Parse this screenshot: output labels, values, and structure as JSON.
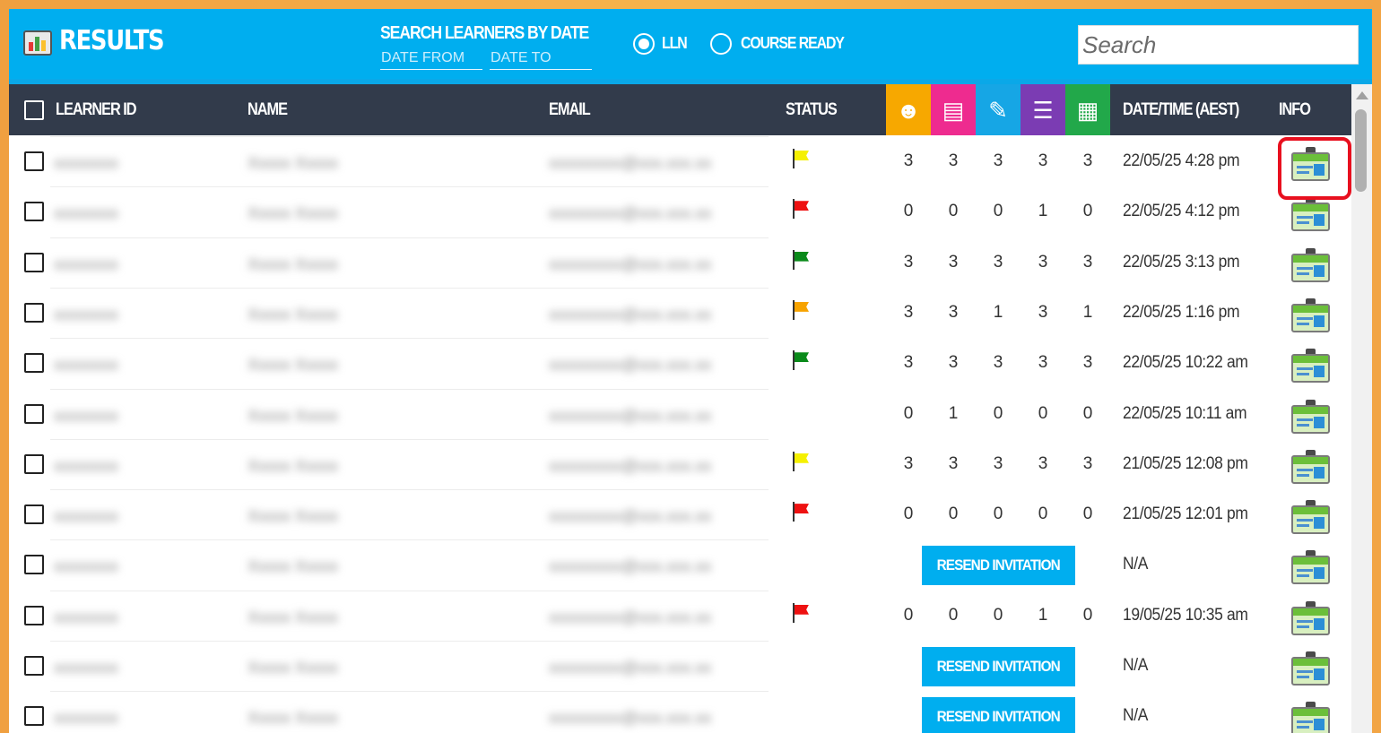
{
  "header": {
    "title": "RESULTS",
    "date_search_title": "SEARCH LEARNERS BY DATE",
    "date_from_placeholder": "DATE FROM",
    "date_to_placeholder": "DATE TO",
    "radio_lln": "LLN",
    "radio_course_ready": "COURSE READY",
    "search_placeholder": "Search"
  },
  "table": {
    "columns": {
      "learner_id": "LEARNER ID",
      "name": "NAME",
      "email": "EMAIL",
      "status": "STATUS",
      "datetime": "DATE/TIME (AEST)",
      "info": "INFO"
    },
    "skill_columns": [
      {
        "icon": "learning-head-icon",
        "color": "#f7a800"
      },
      {
        "icon": "reading-book-icon",
        "color": "#ee2b8f"
      },
      {
        "icon": "writing-pencil-icon",
        "color": "#16a6e5"
      },
      {
        "icon": "speaking-chat-icon",
        "color": "#7b3cb3"
      },
      {
        "icon": "numeracy-calculator-icon",
        "color": "#22a84a"
      }
    ],
    "resend_label": "RESEND INVITATION",
    "rows": [
      {
        "flag": "#f5f000",
        "scores": [
          "3",
          "3",
          "3",
          "3",
          "3"
        ],
        "datetime": "22/05/25 4:28 pm"
      },
      {
        "flag": "#ee1111",
        "scores": [
          "0",
          "0",
          "0",
          "1",
          "0"
        ],
        "datetime": "22/05/25 4:12 pm"
      },
      {
        "flag": "#0a8a1a",
        "scores": [
          "3",
          "3",
          "3",
          "3",
          "3"
        ],
        "datetime": "22/05/25 3:13 pm"
      },
      {
        "flag": "#f7a300",
        "scores": [
          "3",
          "3",
          "1",
          "3",
          "1"
        ],
        "datetime": "22/05/25 1:16 pm"
      },
      {
        "flag": "#0a8a1a",
        "scores": [
          "3",
          "3",
          "3",
          "3",
          "3"
        ],
        "datetime": "22/05/25 10:22 am"
      },
      {
        "flag": "",
        "scores": [
          "0",
          "1",
          "0",
          "0",
          "0"
        ],
        "datetime": "22/05/25 10:11 am"
      },
      {
        "flag": "#f5f000",
        "scores": [
          "3",
          "3",
          "3",
          "3",
          "3"
        ],
        "datetime": "21/05/25 12:08 pm"
      },
      {
        "flag": "#ee1111",
        "scores": [
          "0",
          "0",
          "0",
          "0",
          "0"
        ],
        "datetime": "21/05/25 12:01 pm"
      },
      {
        "resend": true,
        "datetime": "N/A"
      },
      {
        "flag": "#ee1111",
        "scores": [
          "0",
          "0",
          "0",
          "1",
          "0"
        ],
        "datetime": "19/05/25 10:35 am"
      },
      {
        "resend": true,
        "datetime": "N/A"
      },
      {
        "resend": true,
        "datetime": "N/A"
      }
    ]
  }
}
